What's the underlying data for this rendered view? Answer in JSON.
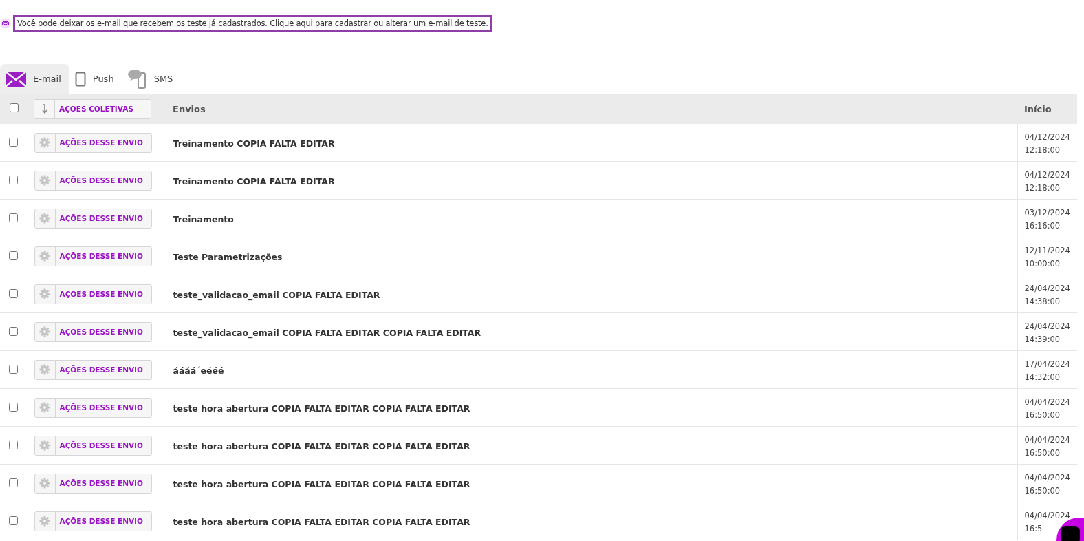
{
  "notice": "Você pode deixar os e-mail que recebem os teste já cadastrados. Clique aqui para cadastrar ou alterar um e-mail de teste.",
  "tabs": [
    {
      "label": "E-mail",
      "kind": "email",
      "selected": true
    },
    {
      "label": "Push",
      "kind": "push",
      "selected": false
    },
    {
      "label": "SMS",
      "kind": "sms",
      "selected": false
    }
  ],
  "table": {
    "select_all": {
      "checked": false
    },
    "bulk_button": "AÇÕES COLETIVAS",
    "columns": [
      "Envios",
      "Início"
    ],
    "rows": [
      {
        "checked": false,
        "action": "AÇÕES DESSE ENVIO",
        "name": "Treinamento COPIA FALTA EDITAR",
        "date": "04/12/2024",
        "time": "12:18:00"
      },
      {
        "checked": false,
        "action": "AÇÕES DESSE ENVIO",
        "name": "Treinamento COPIA FALTA EDITAR",
        "date": "04/12/2024",
        "time": "12:18:00"
      },
      {
        "checked": false,
        "action": "AÇÕES DESSE ENVIO",
        "name": "Treinamento",
        "date": "03/12/2024",
        "time": "16:16:00"
      },
      {
        "checked": false,
        "action": "AÇÕES DESSE ENVIO",
        "name": "Teste Parametrizações",
        "date": "12/11/2024",
        "time": "10:00:00"
      },
      {
        "checked": false,
        "action": "AÇÕES DESSE ENVIO",
        "name": "teste_validacao_email COPIA FALTA EDITAR",
        "date": "24/04/2024",
        "time": "14:38:00"
      },
      {
        "checked": false,
        "action": "AÇÕES DESSE ENVIO",
        "name": "teste_validacao_email COPIA FALTA EDITAR COPIA FALTA EDITAR",
        "date": "24/04/2024",
        "time": "14:39:00"
      },
      {
        "checked": false,
        "action": "AÇÕES DESSE ENVIO",
        "name": "áááá´eééé",
        "date": "17/04/2024",
        "time": "14:32:00"
      },
      {
        "checked": false,
        "action": "AÇÕES DESSE ENVIO",
        "name": "teste hora abertura COPIA FALTA EDITAR COPIA FALTA EDITAR",
        "date": "04/04/2024",
        "time": "16:50:00"
      },
      {
        "checked": false,
        "action": "AÇÕES DESSE ENVIO",
        "name": "teste hora abertura COPIA FALTA EDITAR COPIA FALTA EDITAR",
        "date": "04/04/2024",
        "time": "16:50:00"
      },
      {
        "checked": false,
        "action": "AÇÕES DESSE ENVIO",
        "name": "teste hora abertura COPIA FALTA EDITAR COPIA FALTA EDITAR",
        "date": "04/04/2024",
        "time": "16:50:00"
      },
      {
        "checked": false,
        "action": "AÇÕES DESSE ENVIO",
        "name": "teste hora abertura COPIA FALTA EDITAR COPIA FALTA EDITAR",
        "date": "04/04/2024",
        "time": "16:5"
      }
    ]
  }
}
